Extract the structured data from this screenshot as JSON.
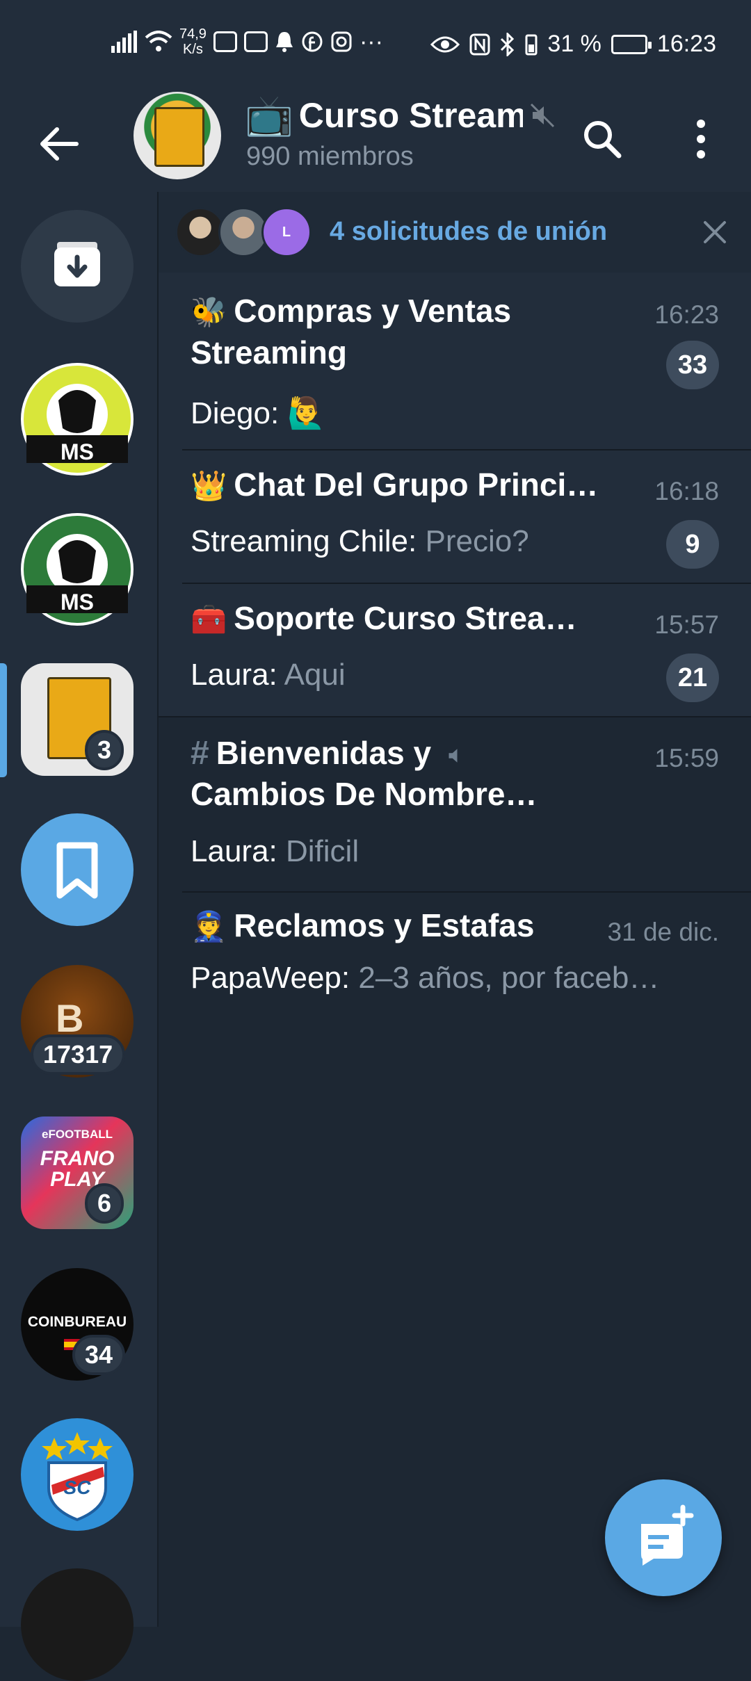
{
  "status_bar": {
    "net_speed": "74,9\nK/s",
    "battery": "31 %",
    "time": "16:23",
    "dots": "···"
  },
  "header": {
    "title_emoji": "📺",
    "title": "Curso Streaming",
    "subtitle": "990 miembros"
  },
  "sidebar": {
    "folders": [
      {
        "name": "archive",
        "badge": ""
      },
      {
        "name": "trading-ms-yellow",
        "badge": "",
        "label": "MS"
      },
      {
        "name": "trading-ms-green",
        "badge": "",
        "label": "MS"
      },
      {
        "name": "curso-streaming",
        "badge": "3"
      },
      {
        "name": "saved-messages",
        "badge": ""
      },
      {
        "name": "business-class",
        "badge": "17317"
      },
      {
        "name": "frano-play",
        "badge": "6",
        "label": "FRANO PLAY",
        "label_top": "eFOOTBALL"
      },
      {
        "name": "coin-bureau",
        "badge": "34",
        "label": "COINBUREAU"
      },
      {
        "name": "sporting-cristal",
        "badge": "",
        "label": "SC"
      }
    ]
  },
  "join_requests": {
    "text": "4 solicitudes de unión",
    "avatar_letter": "L"
  },
  "chats": [
    {
      "emoji": "🐝",
      "title": "Compras y Ventas",
      "title2": "Streaming",
      "time": "16:23",
      "sender": "Diego:",
      "message": "🙋‍♂️",
      "unread": "33"
    },
    {
      "emoji": "👑",
      "title": "Chat Del Grupo Princi…",
      "time": "16:18",
      "sender": "Streaming Chile:",
      "message": "Precio?",
      "unread": "9"
    },
    {
      "emoji": "🧰",
      "title": "Soporte Curso Strea…",
      "time": "15:57",
      "sender": "Laura:",
      "message": "Aqui",
      "unread": "21"
    },
    {
      "emoji": "#",
      "title": "Bienvenidas y",
      "title2": "Cambios De Nombre…",
      "time": "15:59",
      "sender": "Laura:",
      "message": "Dificil",
      "unread": ""
    },
    {
      "emoji": "👮",
      "title": "Reclamos y Estafas",
      "time": "31 de dic.",
      "sender": "PapaWeep:",
      "message": "2–3 años, por faceb…",
      "unread": ""
    }
  ],
  "colors": {
    "accent": "#5aa8e4",
    "background": "#1d2733",
    "header": "#222d3b"
  }
}
